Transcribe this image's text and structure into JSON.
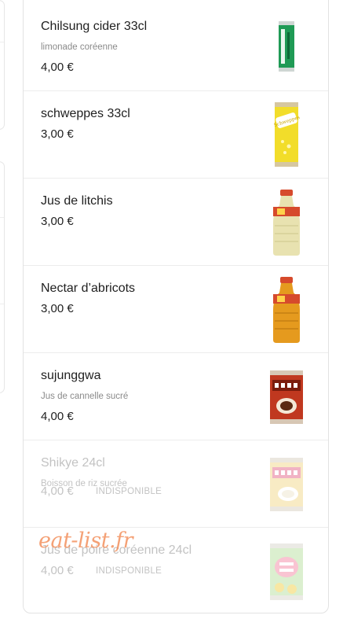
{
  "menu": {
    "items": [
      {
        "name": "Chilsung cider 33cl",
        "description": "limonade coréenne",
        "price": "4,00 €",
        "status": "",
        "available": true,
        "icon": "green-soda-can-icon"
      },
      {
        "name": "schweppes 33cl",
        "description": "",
        "price": "3,00 €",
        "status": "",
        "available": true,
        "icon": "yellow-soda-can-icon"
      },
      {
        "name": "Jus de litchis",
        "description": "",
        "price": "3,00 €",
        "status": "",
        "available": true,
        "icon": "juice-bottle-icon"
      },
      {
        "name": "Nectar d’abricots",
        "description": "",
        "price": "3,00 €",
        "status": "",
        "available": true,
        "icon": "juice-bottle-icon"
      },
      {
        "name": "sujunggwa",
        "description": "Jus de cannelle sucré",
        "price": "4,00 €",
        "status": "",
        "available": true,
        "icon": "cinnamon-drink-can-icon"
      },
      {
        "name": "Shikye 24cl",
        "description": "Boisson de riz sucrée",
        "price": "4,00 €",
        "status": "INDISPONIBLE",
        "available": false,
        "icon": "rice-drink-can-icon"
      },
      {
        "name": "Jus de poire coréenne 24cl",
        "description": "",
        "price": "4,00 €",
        "status": "INDISPONIBLE",
        "available": false,
        "icon": "pear-juice-can-icon"
      }
    ]
  },
  "watermark": "eat-list.fr",
  "colors": {
    "text": "#1f1f1f",
    "muted": "#8a8a8a",
    "disabled": "#c3c3c3",
    "border": "#e2e2e2",
    "watermark": "#f28a55"
  }
}
